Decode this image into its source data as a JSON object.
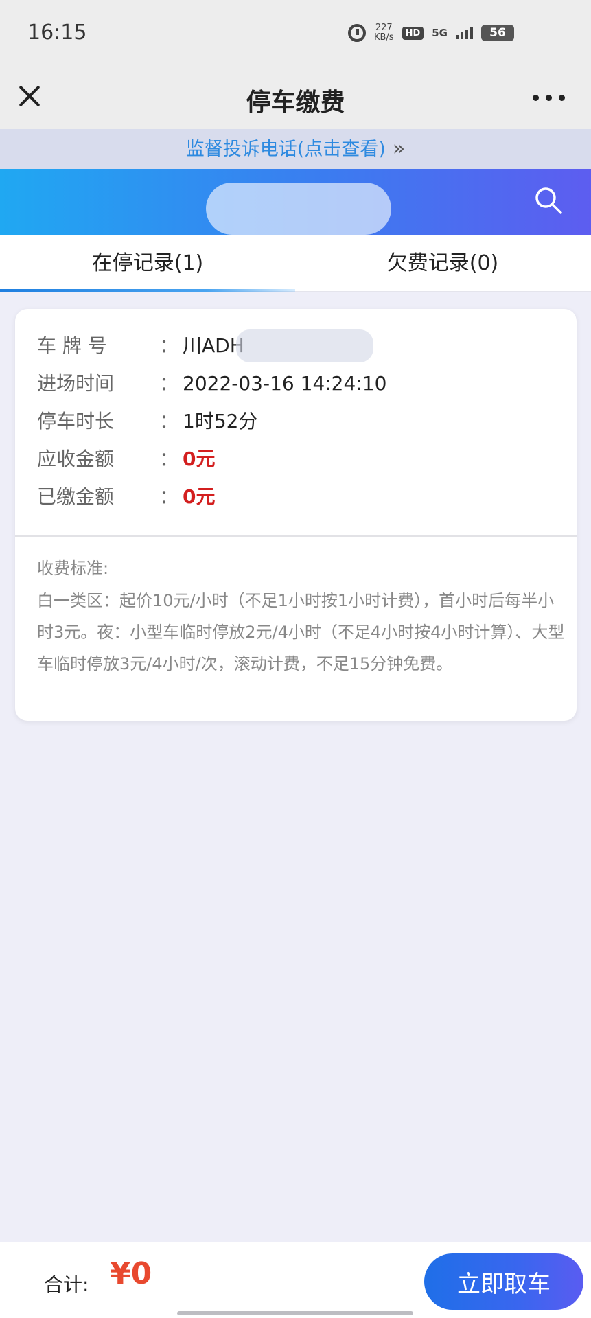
{
  "status_bar": {
    "time": "16:15",
    "net_speed_value": "227",
    "net_speed_unit": "KB/s",
    "hd_badge": "HD",
    "network": "5G",
    "battery": "56"
  },
  "nav": {
    "title": "停车缴费",
    "close_icon": "close-icon",
    "more_icon": "more-icon"
  },
  "banner": {
    "complaint_text": "监督投诉电话(点击查看)",
    "chevron": "»"
  },
  "header": {
    "search_icon": "search-icon",
    "gradient_start": "#20a8f2",
    "gradient_end": "#5d5df0"
  },
  "tabs": [
    {
      "label": "在停记录(1)",
      "active": true
    },
    {
      "label": "欠费记录(0)",
      "active": false
    }
  ],
  "record": {
    "fields": [
      {
        "label": "车 牌 号",
        "colon": "：",
        "value": "川ADH",
        "highlight": false
      },
      {
        "label": "进场时间",
        "colon": "：",
        "value": "2022-03-16 14:24:10",
        "highlight": false
      },
      {
        "label": "停车时长",
        "colon": "：",
        "value": "1时52分",
        "highlight": false
      },
      {
        "label": "应收金额",
        "colon": "：",
        "value": "0元",
        "highlight": true
      },
      {
        "label": "已缴金额",
        "colon": "：",
        "value": "0元",
        "highlight": true
      }
    ],
    "fee_title": "收费标准:",
    "fee_desc": "白一类区：起价10元/小时（不足1小时按1小时计费），首小时后每半小时3元。夜：小型车临时停放2元/4小时（不足4小时按4小时计算）、大型车临时停放3元/4小时/次，滚动计费，不足15分钟免费。"
  },
  "bottom": {
    "total_label": "合计:",
    "total_amount": "¥0",
    "pickup_label": "立即取车",
    "accent_color": "#e8492f"
  }
}
